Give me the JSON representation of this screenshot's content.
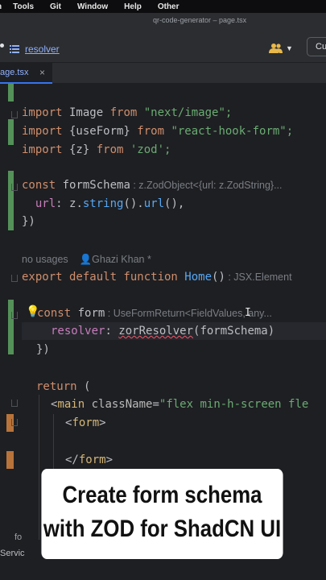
{
  "menubar": {
    "items": [
      "n",
      "Tools",
      "Git",
      "Window",
      "Help",
      "Other"
    ]
  },
  "titlebar": {
    "title": "qr-code-generator – page.tsx"
  },
  "toolbar": {
    "branch": "resolver",
    "button_label": "Cu"
  },
  "tab": {
    "label": "age.tsx",
    "close": "×"
  },
  "code": {
    "import1": {
      "kw": "import",
      "name": " Image ",
      "from": "from",
      "src": " \"next/image\";"
    },
    "import2": {
      "kw": "import",
      "name": " {useForm} ",
      "from": "from",
      "src": " \"react-hook-form\";"
    },
    "import3": {
      "kw": "import",
      "name": " {z} ",
      "from": "from",
      "src": " 'zod';"
    },
    "schema": {
      "kw": "const",
      "name": " formSchema",
      "hint": " : z.ZodObject<{url: z.ZodString}..."
    },
    "url": {
      "indent": "  ",
      "field": "url",
      "rest": ": z.",
      "fn1": "string",
      "mid": "().",
      "fn2": "url",
      "end": "(),"
    },
    "close1": "})",
    "usages": "no usages",
    "author": "Ghazi Khan *",
    "export": {
      "kw": "export default function",
      "fn": " Home",
      "paren": "()",
      "hint": " : JSX.Element"
    },
    "form": {
      "kw": "const",
      "name": " form",
      "hint": " : UseFormReturn<FieldValues, any..."
    },
    "resolver": {
      "field": "resolver",
      "colon": ": ",
      "err": "zorResolver",
      "args": "(formSchema)"
    },
    "close2": "})",
    "return": {
      "kw": "return",
      "paren": " ("
    },
    "main": {
      "open": "<",
      "tag": "main",
      "attr": " className",
      "eq": "=",
      "val": "\"flex min-h-screen fle"
    },
    "form_open": {
      "open": "<",
      "tag": "form",
      "close": ">"
    },
    "form_close": {
      "open": "</",
      "tag": "form",
      "close": ">"
    }
  },
  "caption": {
    "line1": "Create form schema",
    "line2": "with ZOD for ShadCN UI"
  },
  "status": {
    "fo": "fo",
    "services": "Servic"
  },
  "icons": [
    "list-icon",
    "users-icon",
    "close-icon",
    "lightbulb-icon",
    "person-icon"
  ]
}
